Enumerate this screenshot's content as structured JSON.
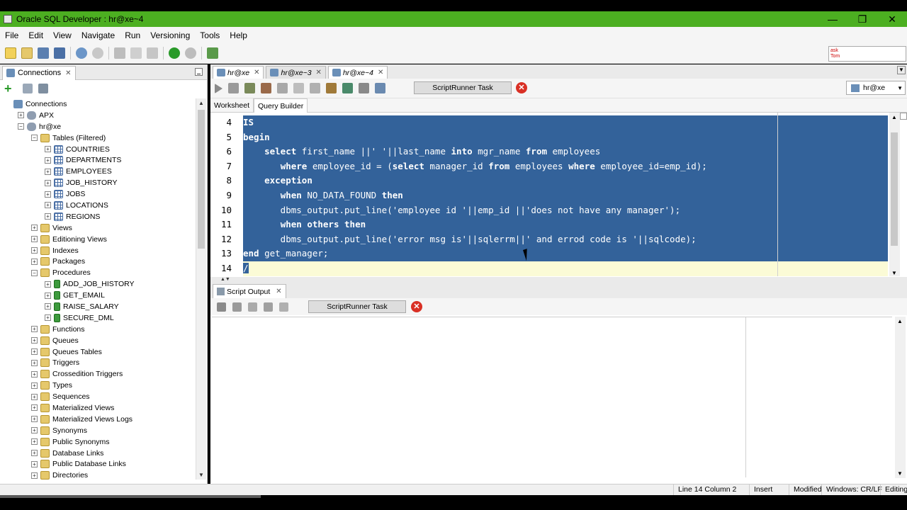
{
  "window": {
    "title": "Oracle SQL Developer : hr@xe~4",
    "controls": [
      "—",
      "❐",
      "✕"
    ]
  },
  "menu": [
    "File",
    "Edit",
    "View",
    "Navigate",
    "Run",
    "Versioning",
    "Tools",
    "Help"
  ],
  "ask_logo": "ask\nTom",
  "connections_panel": {
    "tab_label": "Connections",
    "tree": [
      {
        "label": "Connections",
        "level": 0,
        "expander": "",
        "icon": "conn"
      },
      {
        "label": "APX",
        "level": 1,
        "expander": "+",
        "icon": "db"
      },
      {
        "label": "hr@xe",
        "level": 1,
        "expander": "−",
        "icon": "db"
      },
      {
        "label": "Tables (Filtered)",
        "level": 2,
        "expander": "−",
        "icon": "folder"
      },
      {
        "label": "COUNTRIES",
        "level": 3,
        "expander": "+",
        "icon": "table"
      },
      {
        "label": "DEPARTMENTS",
        "level": 3,
        "expander": "+",
        "icon": "table"
      },
      {
        "label": "EMPLOYEES",
        "level": 3,
        "expander": "+",
        "icon": "table"
      },
      {
        "label": "JOB_HISTORY",
        "level": 3,
        "expander": "+",
        "icon": "table"
      },
      {
        "label": "JOBS",
        "level": 3,
        "expander": "+",
        "icon": "table"
      },
      {
        "label": "LOCATIONS",
        "level": 3,
        "expander": "+",
        "icon": "table"
      },
      {
        "label": "REGIONS",
        "level": 3,
        "expander": "+",
        "icon": "table"
      },
      {
        "label": "Views",
        "level": 2,
        "expander": "+",
        "icon": "folder"
      },
      {
        "label": "Editioning Views",
        "level": 2,
        "expander": "+",
        "icon": "folder"
      },
      {
        "label": "Indexes",
        "level": 2,
        "expander": "+",
        "icon": "folder"
      },
      {
        "label": "Packages",
        "level": 2,
        "expander": "+",
        "icon": "folder"
      },
      {
        "label": "Procedures",
        "level": 2,
        "expander": "−",
        "icon": "folder"
      },
      {
        "label": "ADD_JOB_HISTORY",
        "level": 3,
        "expander": "+",
        "icon": "proc"
      },
      {
        "label": "GET_EMAIL",
        "level": 3,
        "expander": "+",
        "icon": "proc"
      },
      {
        "label": "RAISE_SALARY",
        "level": 3,
        "expander": "+",
        "icon": "proc"
      },
      {
        "label": "SECURE_DML",
        "level": 3,
        "expander": "+",
        "icon": "proc"
      },
      {
        "label": "Functions",
        "level": 2,
        "expander": "+",
        "icon": "folder"
      },
      {
        "label": "Queues",
        "level": 2,
        "expander": "+",
        "icon": "folder"
      },
      {
        "label": "Queues Tables",
        "level": 2,
        "expander": "+",
        "icon": "folder"
      },
      {
        "label": "Triggers",
        "level": 2,
        "expander": "+",
        "icon": "folder"
      },
      {
        "label": "Crossedition Triggers",
        "level": 2,
        "expander": "+",
        "icon": "folder"
      },
      {
        "label": "Types",
        "level": 2,
        "expander": "+",
        "icon": "folder"
      },
      {
        "label": "Sequences",
        "level": 2,
        "expander": "+",
        "icon": "folder"
      },
      {
        "label": "Materialized Views",
        "level": 2,
        "expander": "+",
        "icon": "folder"
      },
      {
        "label": "Materialized Views Logs",
        "level": 2,
        "expander": "+",
        "icon": "folder"
      },
      {
        "label": "Synonyms",
        "level": 2,
        "expander": "+",
        "icon": "folder"
      },
      {
        "label": "Public Synonyms",
        "level": 2,
        "expander": "+",
        "icon": "folder"
      },
      {
        "label": "Database Links",
        "level": 2,
        "expander": "+",
        "icon": "folder"
      },
      {
        "label": "Public Database Links",
        "level": 2,
        "expander": "+",
        "icon": "folder"
      },
      {
        "label": "Directories",
        "level": 2,
        "expander": "+",
        "icon": "folder"
      }
    ]
  },
  "editor": {
    "doc_tabs": [
      "hr@xe",
      "hr@xe~3",
      "hr@xe~4"
    ],
    "active_tab": 2,
    "task_label": "ScriptRunner Task",
    "connection": "hr@xe",
    "sub_tabs": [
      "Worksheet",
      "Query Builder"
    ],
    "lines": [
      {
        "num": "4",
        "text": "IS",
        "state": "sel"
      },
      {
        "num": "5",
        "text": "begin",
        "state": "sel"
      },
      {
        "num": "6",
        "text": "    select first_name ||' '||last_name into mgr_name from employees",
        "state": "sel"
      },
      {
        "num": "7",
        "text": "       where employee_id = (select manager_id from employees where employee_id=emp_id);",
        "state": "sel"
      },
      {
        "num": "8",
        "text": "    exception",
        "state": "sel"
      },
      {
        "num": "9",
        "text": "       when NO_DATA_FOUND then",
        "state": "sel"
      },
      {
        "num": "10",
        "text": "       dbms_output.put_line('employee id '||emp_id ||'does not have any manager');",
        "state": "sel"
      },
      {
        "num": "11",
        "text": "       when others then",
        "state": "sel"
      },
      {
        "num": "12",
        "text": "       dbms_output.put_line('error msg is'||sqlerrm||' and errod code is '||sqlcode);",
        "state": "sel"
      },
      {
        "num": "13",
        "text": "end get_manager;",
        "state": "sel"
      },
      {
        "num": "14",
        "text": "/",
        "state": "cur"
      }
    ]
  },
  "output": {
    "tab_label": "Script Output",
    "task_label": "ScriptRunner Task"
  },
  "status": {
    "position": "Line 14 Column 2",
    "insert_mode": "Insert",
    "modified": "Modified",
    "line_endings": "Windows: CR/LF",
    "mode": "Editing"
  },
  "colors": {
    "titlebar": "#4caf21",
    "selection": "#33629a",
    "current_line": "#fbfbd6"
  }
}
